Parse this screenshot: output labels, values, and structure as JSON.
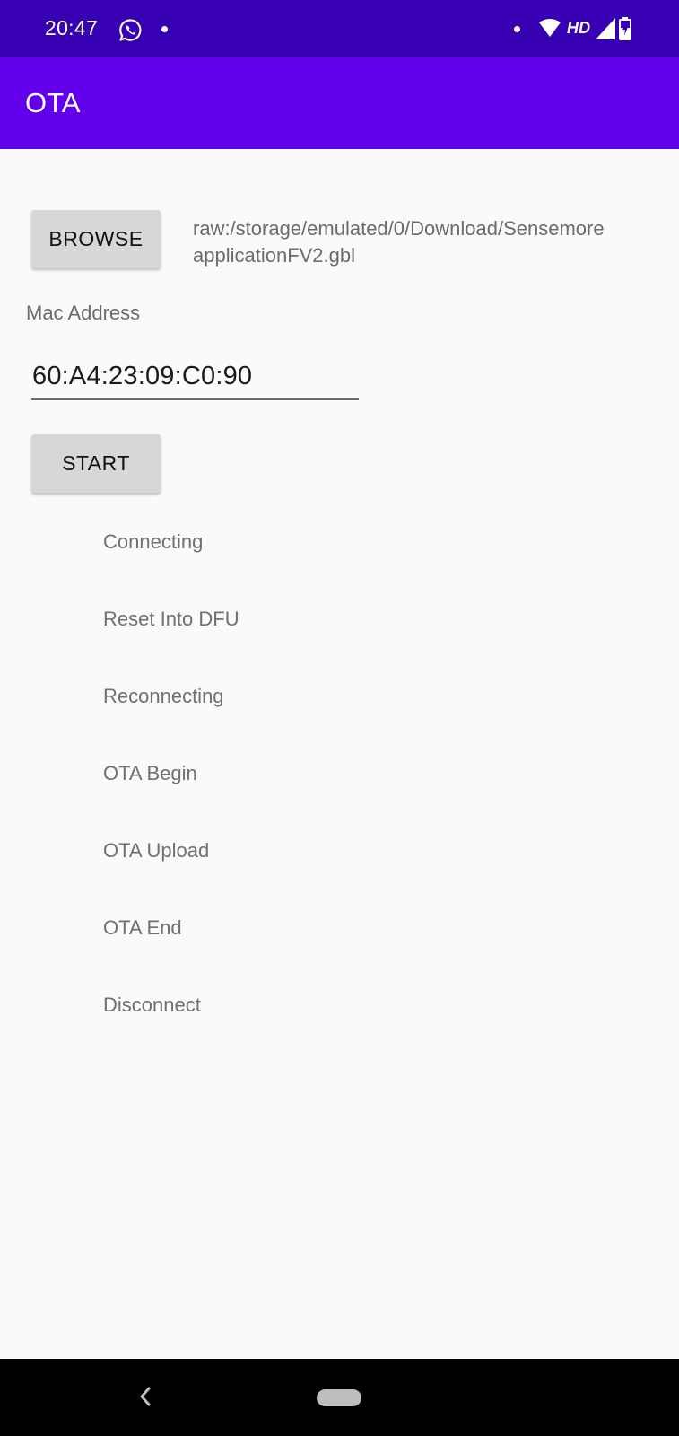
{
  "status_bar": {
    "time": "20:47",
    "network_label": "HD",
    "icons": [
      "whatsapp-icon",
      "notification-dot",
      "wifi-icon",
      "signal-icon",
      "battery-icon"
    ]
  },
  "app_bar": {
    "title": "OTA"
  },
  "browse": {
    "button_label": "BROWSE",
    "file_path_line1": "raw:/storage/emulated/0/Download/Sensemore",
    "file_path_line2": "applicationFV2.gbl"
  },
  "mac": {
    "label": "Mac Address",
    "value": "60:A4:23:09:C0:90"
  },
  "start": {
    "button_label": "START"
  },
  "steps": [
    "Connecting",
    "Reset Into DFU",
    "Reconnecting",
    "OTA Begin",
    "OTA Upload",
    "OTA End",
    "Disconnect"
  ],
  "colors": {
    "status_bar": "#3700b3",
    "app_bar": "#6200ee",
    "background": "#fafafa",
    "button": "#d6d7d7"
  }
}
